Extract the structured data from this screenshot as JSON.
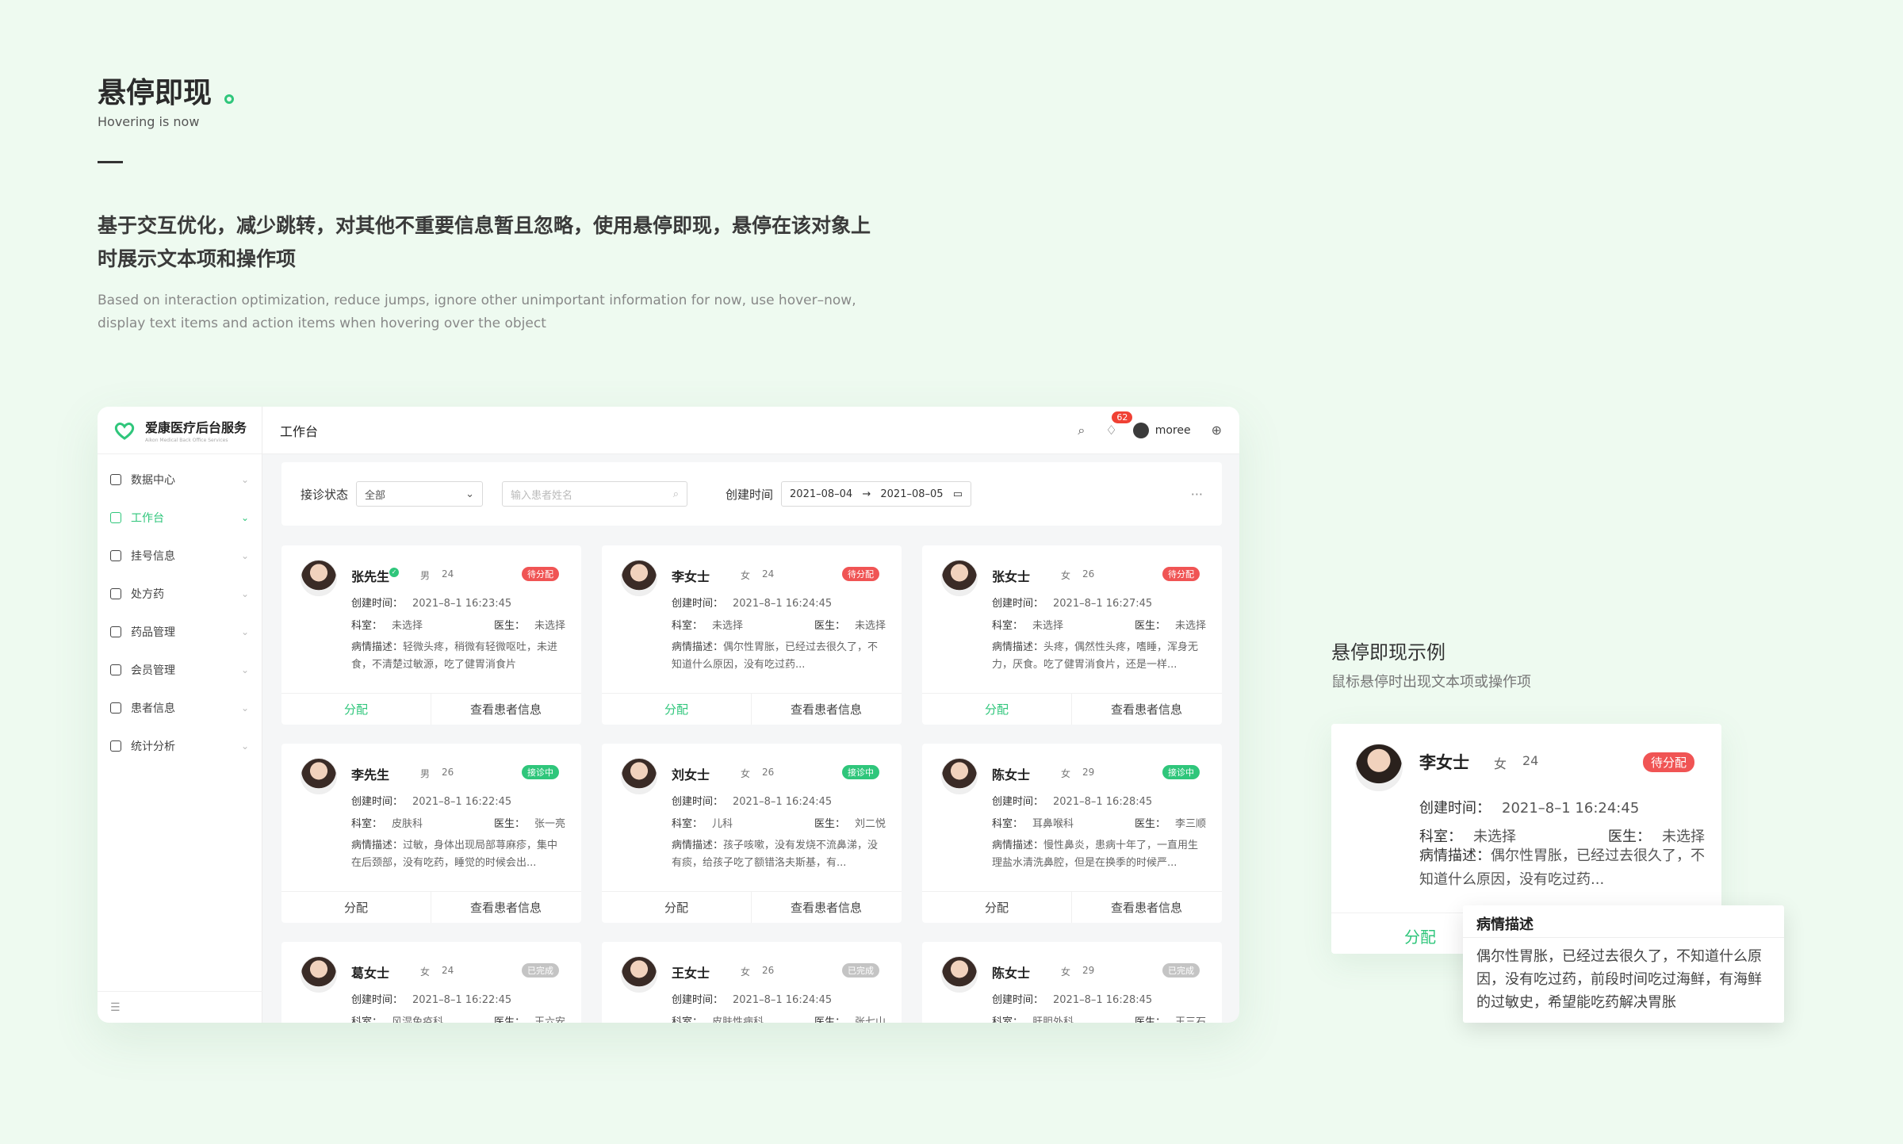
{
  "intro": {
    "title": "悬停即现",
    "subtitle": "Hovering is now",
    "desc_zh": "基于交互优化，减少跳转，对其他不重要信息暂且忽略，使用悬停即现，悬停在该对象上时展示文本项和操作项",
    "desc_en": "Based on interaction optimization, reduce jumps, ignore other unimportant information for now, use hover–now, display text items and action items when hovering over the object"
  },
  "app": {
    "brand_name": "爱康医疗后台服务",
    "brand_en": "Aikon Medical Back Office Services",
    "page_title": "工作台",
    "notif_count": "62",
    "username": "moree",
    "menu": [
      {
        "label": "数据中心",
        "icon": "chart-icon"
      },
      {
        "label": "工作台",
        "icon": "grid-icon",
        "active": true
      },
      {
        "label": "挂号信息",
        "icon": "calendar-icon"
      },
      {
        "label": "处方药",
        "icon": "prescription-icon"
      },
      {
        "label": "药品管理",
        "icon": "pill-icon"
      },
      {
        "label": "会员管理",
        "icon": "diamond-icon"
      },
      {
        "label": "患者信息",
        "icon": "user-icon"
      },
      {
        "label": "统计分析",
        "icon": "clipboard-icon"
      }
    ],
    "filter": {
      "status_label": "接诊状态",
      "status_value": "全部",
      "search_placeholder": "输入患者姓名",
      "date_label": "创建时间",
      "date_start": "2021–08–04",
      "date_end": "2021–08–05"
    },
    "labels": {
      "created": "创建时间：",
      "dept": "科室：",
      "doctor": "医生：",
      "desc": "病情描述：",
      "assign": "分配",
      "view": "查看患者信息"
    },
    "cards": [
      {
        "name": "张先生",
        "sex": "男",
        "age": "24",
        "status": "待分配",
        "status_type": "pending",
        "created": "2021–8–1 16:23:45",
        "dept": "未选择",
        "doctor": "未选择",
        "desc": "轻微头疼，稍微有轻微呕吐，未进食，不清楚过敏源，吃了健胃消食片",
        "verified": true
      },
      {
        "name": "李女士",
        "sex": "女",
        "age": "24",
        "status": "待分配",
        "status_type": "pending",
        "created": "2021–8–1 16:24:45",
        "dept": "未选择",
        "doctor": "未选择",
        "desc": "偶尔性胃胀，已经过去很久了，不知道什么原因，没有吃过药..."
      },
      {
        "name": "张女士",
        "sex": "女",
        "age": "26",
        "status": "待分配",
        "status_type": "pending",
        "created": "2021–8–1 16:27:45",
        "dept": "未选择",
        "doctor": "未选择",
        "desc": "头疼，偶然性头疼，嗜睡，浑身无力，厌食。吃了健胃消食片，还是一样..."
      },
      {
        "name": "李先生",
        "sex": "男",
        "age": "26",
        "status": "接诊中",
        "status_type": "progress",
        "created": "2021–8–1 16:22:45",
        "dept": "皮肤科",
        "doctor": "张一亮",
        "desc": "过敏，身体出现局部荨麻疹，集中在后颈部，没有吃药，睡觉的时候会出..."
      },
      {
        "name": "刘女士",
        "sex": "女",
        "age": "26",
        "status": "接诊中",
        "status_type": "progress",
        "created": "2021–8–1 16:24:45",
        "dept": "儿科",
        "doctor": "刘二悦",
        "desc": "孩子咳嗽，没有发烧不流鼻涕，没有痰，给孩子吃了额错洛夫斯基，有..."
      },
      {
        "name": "陈女士",
        "sex": "女",
        "age": "29",
        "status": "接诊中",
        "status_type": "progress",
        "created": "2021–8–1 16:28:45",
        "dept": "耳鼻喉科",
        "doctor": "李三顺",
        "desc": "慢性鼻炎，患病十年了，一直用生理盐水清洗鼻腔，但是在换季的时候严..."
      },
      {
        "name": "葛女士",
        "sex": "女",
        "age": "24",
        "status": "已完成",
        "status_type": "done",
        "created": "2021–8–1 16:22:45",
        "dept": "风湿免疫科",
        "doctor": "王六安",
        "desc": ""
      },
      {
        "name": "王女士",
        "sex": "女",
        "age": "26",
        "status": "已完成",
        "status_type": "done",
        "created": "2021–8–1 16:24:45",
        "dept": "皮肤性病科",
        "doctor": "张七山",
        "desc": ""
      },
      {
        "name": "陈女士",
        "sex": "女",
        "age": "29",
        "status": "已完成",
        "status_type": "done",
        "created": "2021–8–1 16:28:45",
        "dept": "肝胆外科",
        "doctor": "王三石",
        "desc": ""
      }
    ]
  },
  "example": {
    "title": "悬停即现示例",
    "subtitle": "鼠标悬停时出现文本项或操作项",
    "name": "李女士",
    "sex": "女",
    "age": "24",
    "status": "待分配",
    "created_label": "创建时间：",
    "created": "2021–8–1 16:24:45",
    "dept_label": "科室：",
    "dept": "未选择",
    "doctor_label": "医生：",
    "doctor": "未选择",
    "desc_label": "病情描述：",
    "desc": "偶尔性胃胀，已经过去很久了，不知道什么原因，没有吃过药...",
    "assign": "分配",
    "tooltip_title": "病情描述",
    "tooltip_body": "偶尔性胃胀，已经过去很久了，不知道什么原因，没有吃过药，前段时间吃过海鲜，有海鲜的过敏史，希望能吃药解决胃胀"
  },
  "colors": {
    "accent": "#2fc67b",
    "pending": "#f05454",
    "done": "#c4c4c4"
  }
}
